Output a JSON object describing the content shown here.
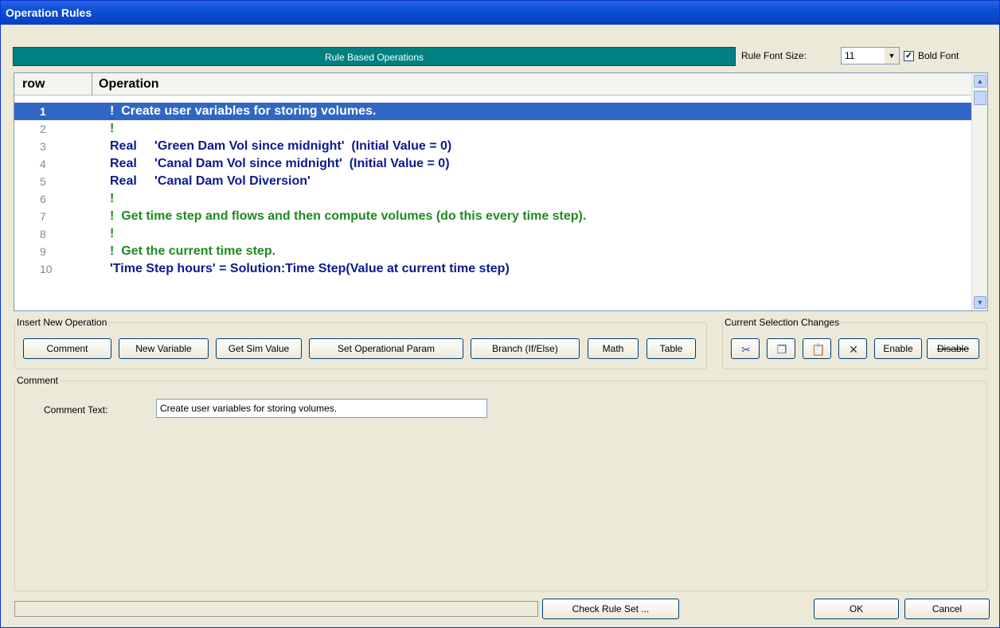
{
  "window": {
    "title": "Operation Rules"
  },
  "header": {
    "title": "Rule Based Operations",
    "font_size_label": "Rule Font Size:",
    "font_size_value": "11",
    "bold_label": "Bold Font",
    "bold_checked": true
  },
  "grid": {
    "columns": [
      "row",
      "Operation"
    ],
    "rows": [
      {
        "num": "1",
        "text": "!  Create user variables for storing volumes.",
        "kind": "comment",
        "selected": true
      },
      {
        "num": "2",
        "text": "!",
        "kind": "comment"
      },
      {
        "num": "3",
        "text": "Real     'Green Dam Vol since midnight'  (Initial Value = 0)",
        "kind": "code"
      },
      {
        "num": "4",
        "text": "Real     'Canal Dam Vol since midnight'  (Initial Value = 0)",
        "kind": "code"
      },
      {
        "num": "5",
        "text": "Real     'Canal Dam Vol Diversion'",
        "kind": "code"
      },
      {
        "num": "6",
        "text": "!",
        "kind": "comment"
      },
      {
        "num": "7",
        "text": "!  Get time step and flows and then compute volumes (do this every time step).",
        "kind": "comment"
      },
      {
        "num": "8",
        "text": "!",
        "kind": "comment"
      },
      {
        "num": "9",
        "text": "!  Get the current time step.",
        "kind": "comment"
      },
      {
        "num": "10",
        "text": "'Time Step hours' = Solution:Time Step(Value at current time step)",
        "kind": "code"
      }
    ]
  },
  "insert": {
    "legend": "Insert New Operation",
    "buttons": [
      "Comment",
      "New Variable",
      "Get Sim Value",
      "Set Operational Param",
      "Branch (If/Else)",
      "Math",
      "Table"
    ]
  },
  "selection": {
    "legend": "Current Selection Changes",
    "enable_label": "Enable",
    "disable_label": "Disable",
    "icons": [
      "cut-icon",
      "copy-icon",
      "paste-icon",
      "delete-icon"
    ]
  },
  "comment": {
    "legend": "Comment",
    "label": "Comment Text:",
    "value": "Create user variables for storing volumes."
  },
  "footer": {
    "check_label": "Check Rule Set ...",
    "ok_label": "OK",
    "cancel_label": "Cancel"
  },
  "colors": {
    "header": "#008080",
    "selection": "#3167c4",
    "comment": "#1f8a1f",
    "code": "#0c1a8c"
  }
}
